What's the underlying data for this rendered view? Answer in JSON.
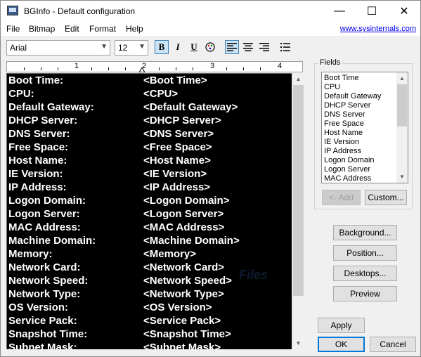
{
  "window": {
    "title": "BGInfo - Default configuration",
    "controls": {
      "minimize": "—",
      "maximize": "☐",
      "close": "✕"
    }
  },
  "menu": {
    "items": [
      "File",
      "Bitmap",
      "Edit",
      "Format",
      "Help"
    ],
    "link": "www.sysinternals.com"
  },
  "toolbar": {
    "font": "Arial",
    "size": "12",
    "bold": "B",
    "italic": "I",
    "underline": "U",
    "active": [
      "bold",
      "align-left"
    ]
  },
  "ruler": {
    "numbers": [
      "1",
      "2",
      "3",
      "4"
    ]
  },
  "editor": {
    "rows": [
      {
        "label": "Boot Time:",
        "value": "<Boot Time>"
      },
      {
        "label": "CPU:",
        "value": "<CPU>"
      },
      {
        "label": "Default Gateway:",
        "value": "<Default Gateway>"
      },
      {
        "label": "DHCP Server:",
        "value": "<DHCP Server>"
      },
      {
        "label": "DNS Server:",
        "value": "<DNS Server>"
      },
      {
        "label": "Free Space:",
        "value": "<Free Space>"
      },
      {
        "label": "Host Name:",
        "value": "<Host Name>"
      },
      {
        "label": "IE Version:",
        "value": "<IE Version>"
      },
      {
        "label": "IP Address:",
        "value": "<IP Address>"
      },
      {
        "label": "Logon Domain:",
        "value": "<Logon Domain>"
      },
      {
        "label": "Logon Server:",
        "value": "<Logon Server>"
      },
      {
        "label": "MAC Address:",
        "value": "<MAC Address>"
      },
      {
        "label": "Machine Domain:",
        "value": "<Machine Domain>"
      },
      {
        "label": "Memory:",
        "value": "<Memory>"
      },
      {
        "label": "Network Card:",
        "value": "<Network Card>"
      },
      {
        "label": "Network Speed:",
        "value": "<Network Speed>"
      },
      {
        "label": "Network Type:",
        "value": "<Network Type>"
      },
      {
        "label": "OS Version:",
        "value": "<OS Version>"
      },
      {
        "label": "Service Pack:",
        "value": "<Service Pack>"
      },
      {
        "label": "Snapshot Time:",
        "value": "<Snapshot Time>"
      },
      {
        "label": "Subnet Mask:",
        "value": "<Subnet Mask>"
      }
    ],
    "watermark": "Files"
  },
  "fields": {
    "legend": "Fields",
    "items": [
      "Boot Time",
      "CPU",
      "Default Gateway",
      "DHCP Server",
      "DNS Server",
      "Free Space",
      "Host Name",
      "IE Version",
      "IP Address",
      "Logon Domain",
      "Logon Server",
      "MAC Address"
    ],
    "add_label": "<- Add",
    "custom_label": "Custom..."
  },
  "buttons": {
    "background": "Background...",
    "position": "Position...",
    "desktops": "Desktops...",
    "preview": "Preview",
    "apply": "Apply",
    "ok": "OK",
    "cancel": "Cancel"
  },
  "colors": {
    "editor_bg": "#000000",
    "editor_text": "#ffffff",
    "link": "#0000ee",
    "accent": "#0078d7"
  }
}
